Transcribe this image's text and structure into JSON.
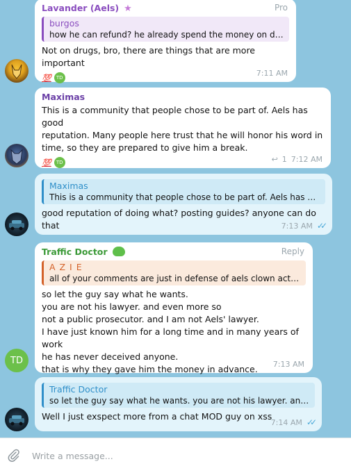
{
  "messages": [
    {
      "sender": "Lavander (Aels)",
      "role": "Pro",
      "quote_name": "burgos",
      "quote_text": "how he can refund? he already spend the money on dr...",
      "text": "Not on drugs, bro, there are things that are more important",
      "reaction_emoji": "💯",
      "reaction_avatar": "TD",
      "time": "7:11 AM"
    },
    {
      "sender": "Maximas",
      "text": "This is a community that people chose to be part of.  Aels has good\nreputation. Many people here  trust that he will honor his word in\ntime, so they are prepared to give him a break.",
      "reaction_emoji": "💯",
      "reaction_avatar": "TD",
      "reply_count": "1",
      "time": "7:12 AM"
    },
    {
      "quote_name": "Maximas",
      "quote_text": "This is a community that people chose to be part of.  Aels has go...",
      "text": "good reputation of doing what? posting guides? anyone can do that",
      "time": "7:13 AM"
    },
    {
      "sender": "Traffic Doctor",
      "role": "Reply",
      "quote_name": "A Z I E",
      "quote_text": "all of  your comments are just in defense of aels clown activi...",
      "text": "so let the guy say what he wants.\nyou are not his lawyer. and even more so\nnot a public prosecutor. and I am not Aels' lawyer.\nI have just known him for a long time and in many years of work\nhe has never deceived anyone.\nthat is why they gave him the money in advance.",
      "avatar_text": "TD",
      "time": "7:13 AM"
    },
    {
      "quote_name": "Traffic Doctor",
      "quote_text": "so let the guy say what he wants. you are not his lawyer. and ...",
      "text": "Well I just exspect more from a chat MOD guy on xss",
      "time": "7:14 AM"
    }
  ],
  "composer": {
    "placeholder": "Write a message..."
  },
  "colors": {
    "lavander": "#8a4dbf",
    "maximas": "#6a3fa6",
    "traffic": "#3c9a38",
    "azie": "#d4622a",
    "blue_quote": "#2f8fc9"
  }
}
